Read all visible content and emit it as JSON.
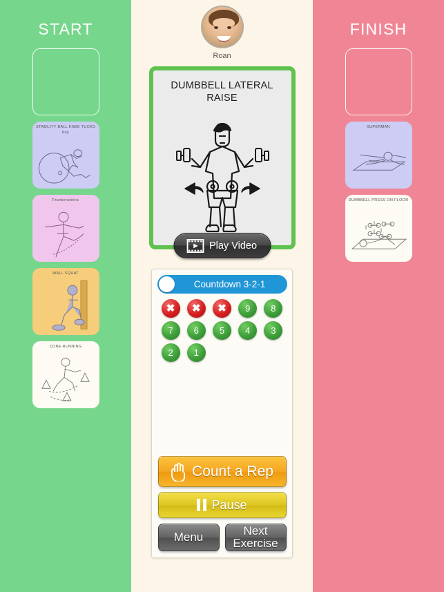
{
  "start_panel": {
    "title": "START",
    "cards": [
      {
        "label": "",
        "style": "placeholder",
        "art": "none"
      },
      {
        "label": "STABILITY BALL KNEE TUCKS boy",
        "style": "lavender",
        "art": "stability-ball-knee-tucks"
      },
      {
        "label": "Frankensteins",
        "style": "pink",
        "art": "frankensteins"
      },
      {
        "label": "WALL SQUAT",
        "style": "tan",
        "art": "wall-squat"
      },
      {
        "label": "CONE RUNNING",
        "style": "white",
        "art": "cone-running"
      }
    ]
  },
  "finish_panel": {
    "title": "FINISH",
    "cards": [
      {
        "label": "",
        "style": "placeholder",
        "art": "none"
      },
      {
        "label": "SUPERMAN",
        "style": "lavender",
        "art": "superman"
      },
      {
        "label": "DUMBBELL PRESS ON FLOOR",
        "style": "white",
        "art": "dumbbell-press-on-floor"
      }
    ]
  },
  "profile": {
    "name": "Roan",
    "avatar_alt": "child-photo"
  },
  "current_exercise": {
    "title": "DUMBBELL LATERAL RAISE",
    "play_video_label": "Play Video",
    "border_color": "#5fc24f"
  },
  "countdown": {
    "toggle_label": "Countdown 3-2-1",
    "toggle_on": false,
    "beads": [
      {
        "value": "✖",
        "state": "used"
      },
      {
        "value": "✖",
        "state": "used"
      },
      {
        "value": "✖",
        "state": "used"
      },
      {
        "value": "9",
        "state": "remaining"
      },
      {
        "value": "8",
        "state": "remaining"
      },
      {
        "value": "7",
        "state": "remaining"
      },
      {
        "value": "6",
        "state": "remaining"
      },
      {
        "value": "5",
        "state": "remaining"
      },
      {
        "value": "4",
        "state": "remaining"
      },
      {
        "value": "3",
        "state": "remaining"
      },
      {
        "value": "2",
        "state": "remaining"
      },
      {
        "value": "1",
        "state": "remaining"
      }
    ]
  },
  "controls": {
    "count_rep_label": "Count a Rep",
    "pause_label": "Pause",
    "menu_label": "Menu",
    "next_exercise_label": "Next Exercise"
  },
  "colors": {
    "start_panel": "#76d68b",
    "finish_panel": "#f08695",
    "center_bg": "#fdf6e8",
    "accent_green": "#5fc24f",
    "toggle_blue": "#2196d6",
    "count_orange": "#f5a623",
    "pause_yellow": "#ddc523"
  }
}
